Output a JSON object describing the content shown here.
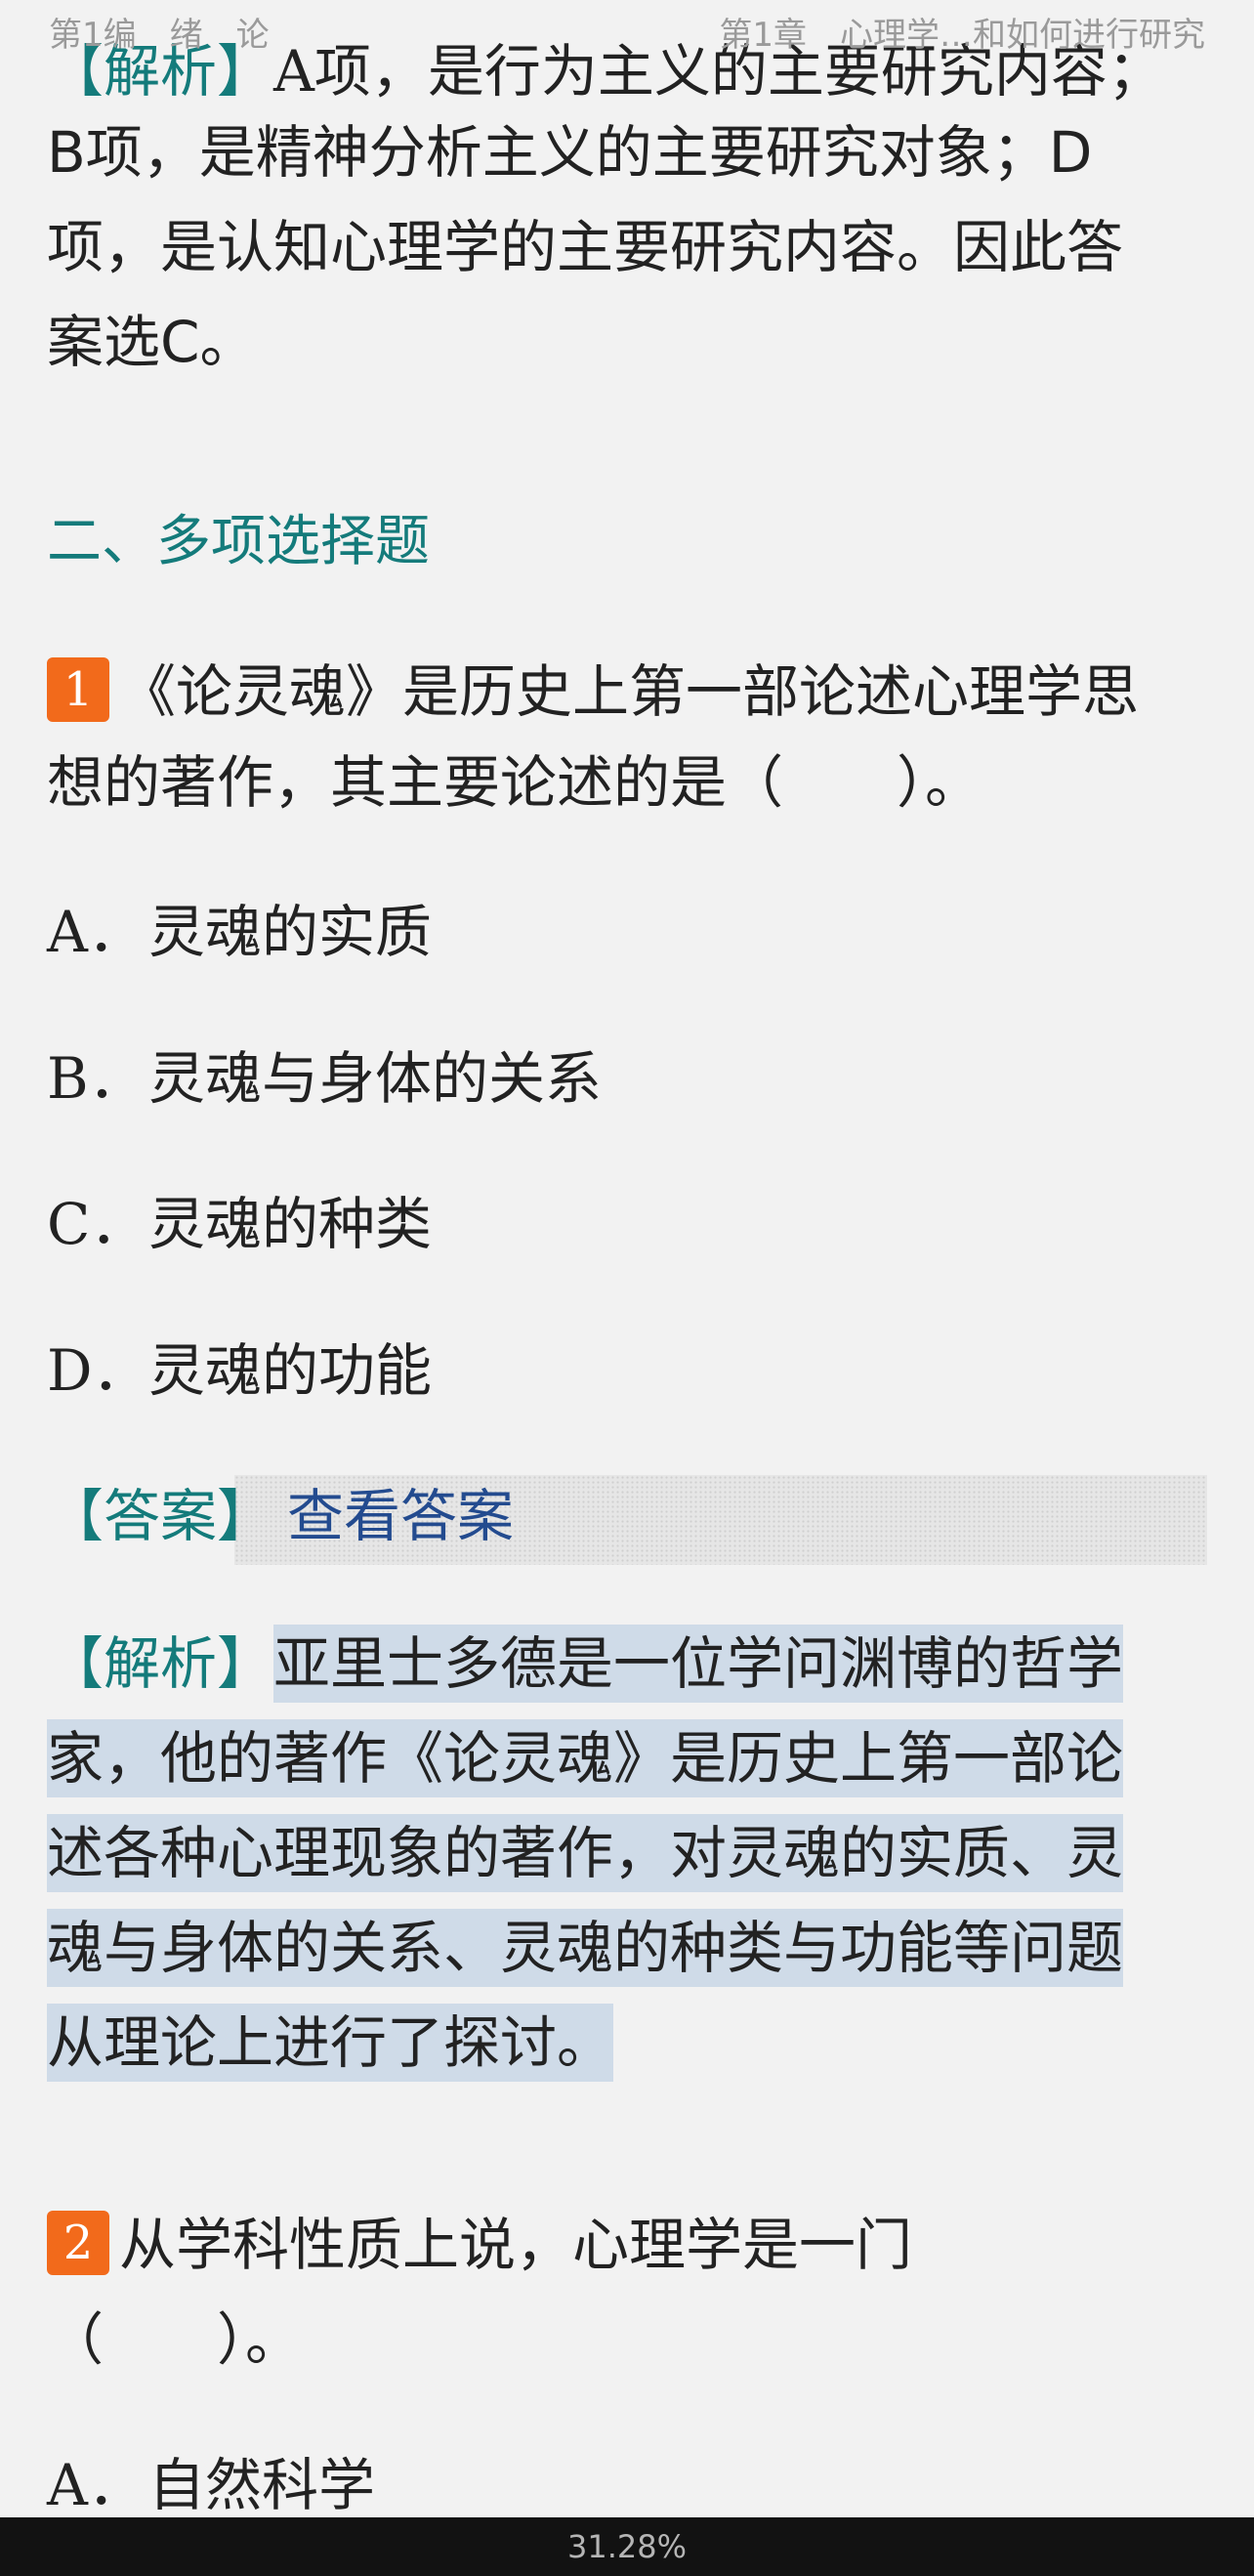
{
  "header": {
    "left": "第1编　绪　论",
    "right": "第1章　心理学…和如何进行研究"
  },
  "prev_explanation": {
    "tag": "【解析】",
    "text_line1_rest": "A项，是行为主义的主要研究内容；",
    "text_line2": "B项，是精神分析主义的主要研究对象；D",
    "text_line3": "项，是认知心理学的主要研究内容。因此答",
    "text_line4": "案选C。"
  },
  "section": {
    "title": "二、多项选择题"
  },
  "question1": {
    "number": "1",
    "line1": "《论灵魂》是历史上第一部论述心理学思",
    "line2": "想的著作，其主要论述的是（　　）。",
    "options": [
      {
        "letter": "A．",
        "text": "灵魂的实质"
      },
      {
        "letter": "B．",
        "text": "灵魂与身体的关系"
      },
      {
        "letter": "C．",
        "text": "灵魂的种类"
      },
      {
        "letter": "D．",
        "text": "灵魂的功能"
      }
    ],
    "answer_tag": "【答案】",
    "answer_link": "查看答案",
    "explanation_tag": "【解析】",
    "explanation_line1": "亚里士多德是一位学问渊博的哲学",
    "explanation_line2": "家，他的著作《论灵魂》是历史上第一部论",
    "explanation_line3": "述各种心理现象的著作，对灵魂的实质、灵",
    "explanation_line4": "魂与身体的关系、灵魂的种类与功能等问题",
    "explanation_line5": "从理论上进行了探讨。"
  },
  "question2": {
    "number": "2",
    "line1": "从学科性质上说，心理学是一门",
    "line2": "（　　）。",
    "options": [
      {
        "letter": "A．",
        "text": "自然科学"
      }
    ]
  },
  "footer": {
    "progress": "31.28%"
  },
  "colors": {
    "background": "#f2f2f2",
    "teal": "#147b7b",
    "badge": "#f26a1b",
    "highlight": "#cfdbe8",
    "link": "#234b8f",
    "footer_bg": "#121212"
  }
}
